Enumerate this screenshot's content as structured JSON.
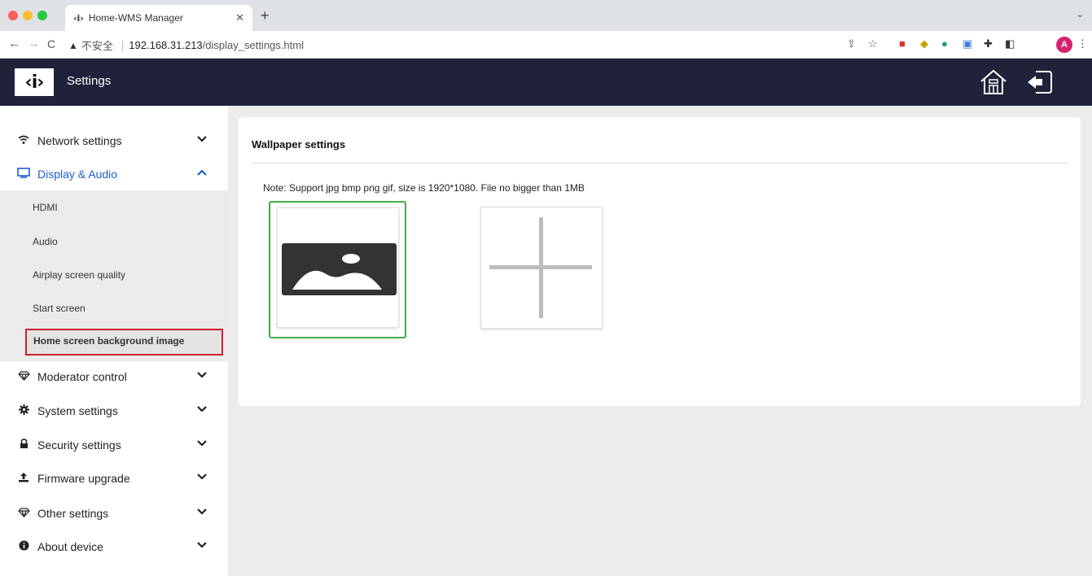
{
  "browser": {
    "tab_title": "Home-WMS Manager",
    "tab_favicon": "‹i›",
    "new_tab": "+",
    "url_insecure_label": "不安全",
    "url_host": "192.168.31.213",
    "url_path": "/display_settings.html",
    "avatar_letter": "A"
  },
  "header": {
    "logo_text": "‹i›",
    "title": "Settings"
  },
  "sidebar": {
    "items": [
      {
        "label": "Network settings",
        "icon": "wifi-icon"
      },
      {
        "label": "Display & Audio",
        "icon": "monitor-icon"
      },
      {
        "label": "Moderator control",
        "icon": "diamond-icon"
      },
      {
        "label": "System settings",
        "icon": "gear-icon"
      },
      {
        "label": "Security settings",
        "icon": "lock-icon"
      },
      {
        "label": "Firmware upgrade",
        "icon": "upload-icon"
      },
      {
        "label": "Other settings",
        "icon": "diamond-icon"
      },
      {
        "label": "About device",
        "icon": "info-icon"
      }
    ],
    "submenu": [
      {
        "label": "HDMI"
      },
      {
        "label": "Audio"
      },
      {
        "label": "Airplay screen quality"
      },
      {
        "label": "Start screen"
      },
      {
        "label": "Home screen background image"
      }
    ]
  },
  "panel": {
    "title": "Wallpaper settings",
    "note": "Note: Support jpg bmp png gif, size is 1920*1080. File no bigger than 1MB"
  },
  "colors": {
    "header_bg": "#1f2239",
    "accent": "#1a5fd0",
    "selected_border": "#4aa94d",
    "highlight_border": "#cc1f2d"
  }
}
